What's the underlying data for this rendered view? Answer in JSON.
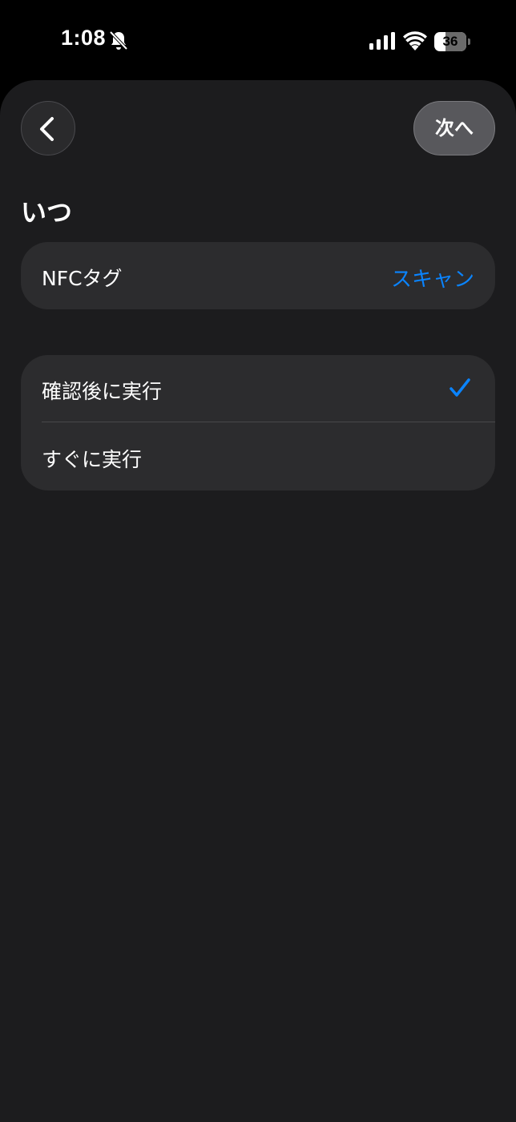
{
  "status_bar": {
    "time": "1:08",
    "battery": "36",
    "battery_level": 0.36
  },
  "nav": {
    "next_label": "次へ"
  },
  "page": {
    "title": "いつ"
  },
  "trigger": {
    "label": "NFCタグ",
    "action_label": "スキャン"
  },
  "options": [
    {
      "label": "確認後に実行",
      "selected": true
    },
    {
      "label": "すぐに実行",
      "selected": false
    }
  ],
  "colors": {
    "accent": "#0a84ff",
    "background": "#1c1c1e",
    "card": "#2c2c2e"
  }
}
